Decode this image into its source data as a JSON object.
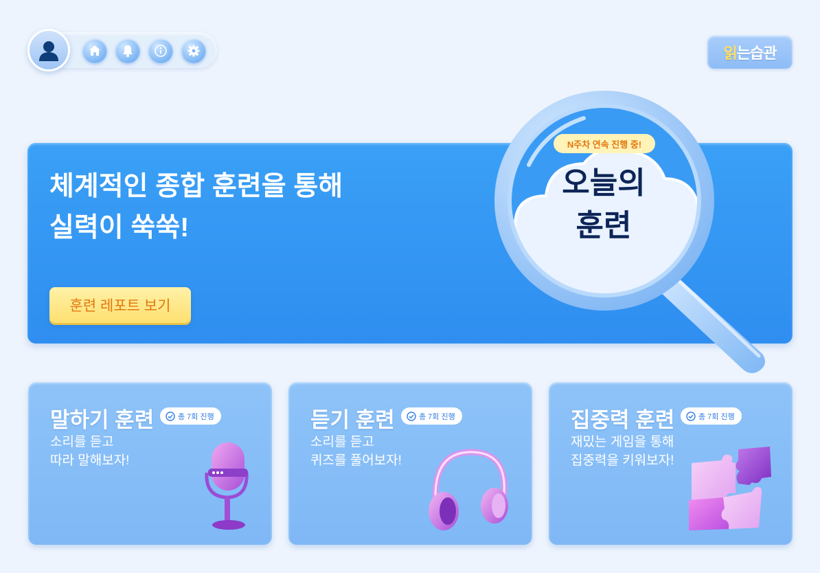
{
  "top_nav": {
    "icons": [
      "user-avatar-icon",
      "home-icon",
      "bell-icon",
      "info-icon",
      "gear-icon"
    ]
  },
  "logo": {
    "text_first": "읽",
    "text_rest": "는습관"
  },
  "hero": {
    "title": "체계적인 종합 훈련을 통해\n실력이 쑥쑥!",
    "report_button": "훈련 레포트 보기",
    "streak_badge": "N주차 연속 진행 중!",
    "today_label": "오늘의\n훈련"
  },
  "cards": [
    {
      "title": "말하기 훈련",
      "badge": "총 7회 진행",
      "description": "소리를 듣고\n따라 말해보자!",
      "art": "microphone-icon"
    },
    {
      "title": "듣기 훈련",
      "badge": "총 7회 진행",
      "description": "소리를 듣고\n퀴즈를 풀어보자!",
      "art": "headphones-icon"
    },
    {
      "title": "집중력 훈련",
      "badge": "총 7회 진행",
      "description": "재밌는 게임을 통해\n집중력을 키워보자!",
      "art": "puzzle-icon"
    }
  ],
  "colors": {
    "background": "#eef4fd",
    "hero_blue": "#3aa0f6",
    "card_blue": "#8ec3f8",
    "button_yellow": "#ffe070",
    "button_text": "#e2770e",
    "today_text": "#0d2557"
  }
}
